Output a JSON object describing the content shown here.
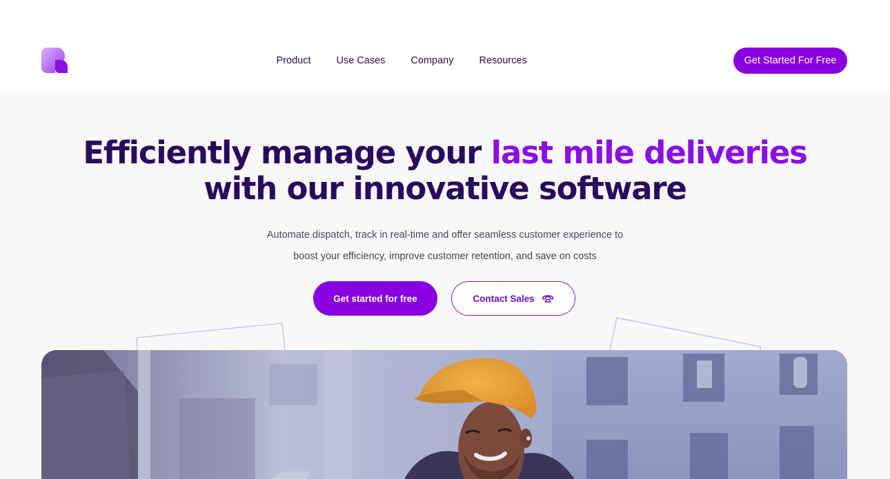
{
  "nav": {
    "items": [
      {
        "label": "Product"
      },
      {
        "label": "Use Cases"
      },
      {
        "label": "Company"
      },
      {
        "label": "Resources"
      }
    ],
    "cta_label": "Get Started For Free"
  },
  "hero": {
    "headline_part1": "Efficiently manage your ",
    "headline_accent": "last mile deliveries",
    "headline_part2": "with our innovative software",
    "subtext_line1": "Automate dispatch, track in real-time and offer seamless customer experience to",
    "subtext_line2": "boost your efficiency, improve customer retention, and save on costs",
    "primary_button": "Get started for free",
    "secondary_button": "Contact Sales",
    "secondary_button_icon": "phone-icon"
  },
  "colors": {
    "brand_purple": "#8800e0",
    "headline_dark": "#2a0a5e",
    "accent": "#8a0fe3",
    "hero_bg": "#f8f8f8"
  }
}
